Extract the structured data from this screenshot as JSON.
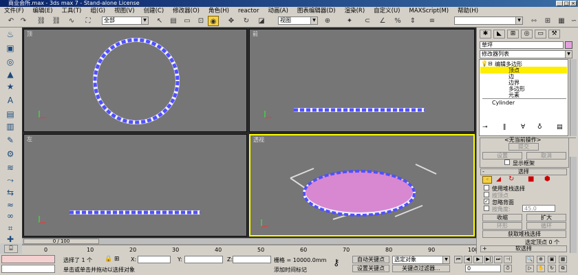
{
  "window": {
    "title": "商业会所.max - 3ds max 7 - Stand-alone License"
  },
  "menu": [
    "文件(F)",
    "编辑(E)",
    "工具(T)",
    "组(G)",
    "视图(V)",
    "创建(C)",
    "修改器(O)",
    "角色(H)",
    "reactor",
    "动画(A)",
    "图表编辑器(D)",
    "渲染(R)",
    "自定义(U)",
    "MAXScript(M)",
    "帮助(H)"
  ],
  "toolbar": {
    "selection_filter": "全部",
    "ref_coord": "视图"
  },
  "viewports": {
    "top": "顶",
    "front": "前",
    "left": "左",
    "persp": "透视"
  },
  "colors": {
    "mesh_blue": "#5050ff",
    "selection_pink": "#d888d0",
    "active_border": "#ffff00"
  },
  "time": {
    "slider": "0 / 100",
    "ticks": [
      "0",
      "10",
      "20",
      "30",
      "40",
      "50",
      "60",
      "70",
      "80",
      "90",
      "100"
    ]
  },
  "status": {
    "selected": "选择了 1 个",
    "x_label": "X:",
    "y_label": "Y:",
    "z_label": "Z:",
    "grid": "栅格 = 10000.0mm",
    "hint": "单击或单击并拖动以选择对象",
    "add_time_tag": "添加时间标记",
    "auto_key": "自动关键点",
    "set_key": "设置关键点",
    "selected_objects": "选定对象",
    "key_filters": "关键点过滤器...",
    "frame": "0"
  },
  "panel": {
    "object_name": "草坪",
    "modifier_list": "修改器列表",
    "stack": {
      "root": "编辑多边形",
      "subs": [
        "顶点",
        "边",
        "边界",
        "多边形",
        "元素"
      ],
      "base": "Cylinder"
    },
    "soft": {
      "header": "<无当前操作>",
      "submit": "提交",
      "settings": "设置",
      "cancel": "取消",
      "show_cage": "显示框架"
    },
    "selection": {
      "header": "选择",
      "use_stack": "使用堆栈选择",
      "by_vertex": "按顶点",
      "ignore_backface": "忽略背面",
      "by_angle": "按角度:",
      "angle_value": "45.0",
      "shrink": "收缩",
      "grow": "扩大",
      "ring": "环形",
      "loop": "循环",
      "get_stack": "获取堆栈选择",
      "selected_count": "选定顶点 0 个"
    },
    "soft_select": "软选择"
  }
}
